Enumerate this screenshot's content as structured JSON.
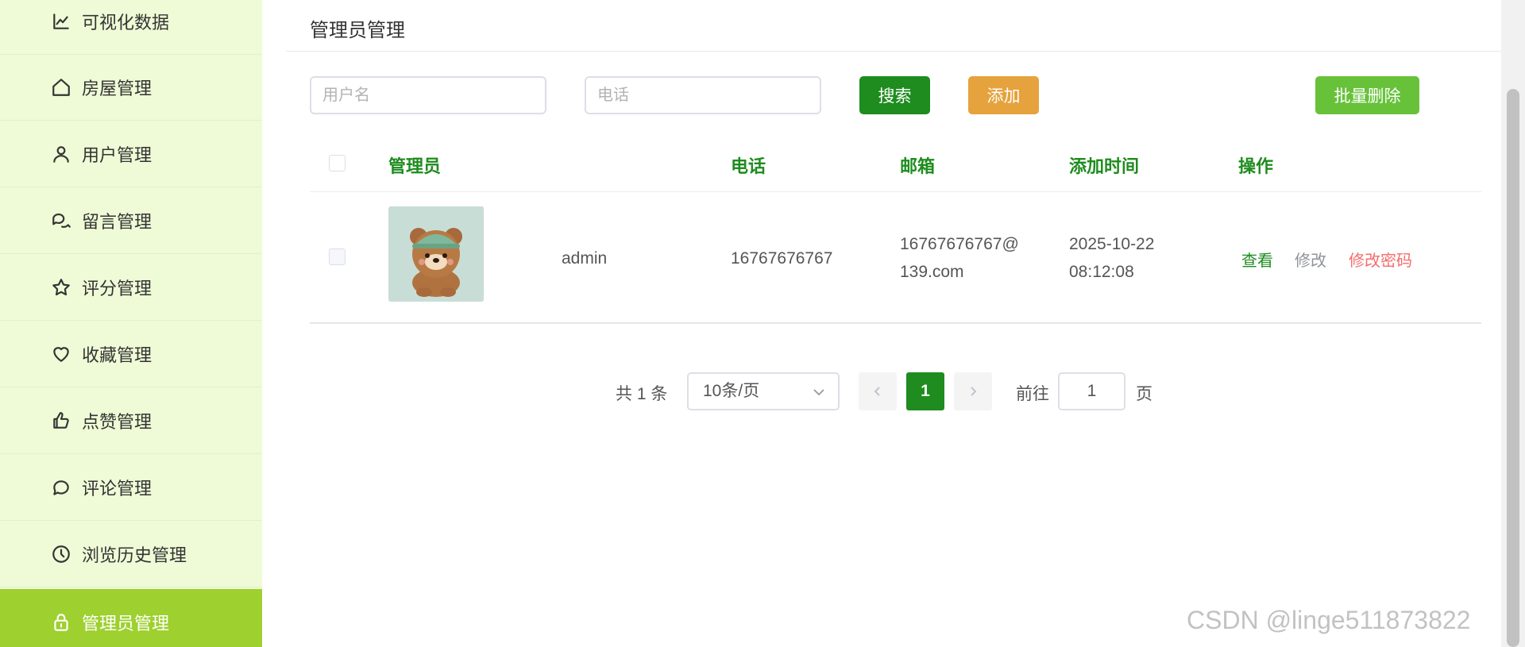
{
  "sidebar": {
    "items": [
      {
        "label": "可视化数据",
        "icon": "chart-line-icon"
      },
      {
        "label": "房屋管理",
        "icon": "home-icon"
      },
      {
        "label": "用户管理",
        "icon": "user-icon"
      },
      {
        "label": "留言管理",
        "icon": "chat-bubbles-icon"
      },
      {
        "label": "评分管理",
        "icon": "star-icon"
      },
      {
        "label": "收藏管理",
        "icon": "heart-icon"
      },
      {
        "label": "点赞管理",
        "icon": "thumbs-up-icon"
      },
      {
        "label": "评论管理",
        "icon": "comment-icon"
      },
      {
        "label": "浏览历史管理",
        "icon": "clock-icon"
      },
      {
        "label": "管理员管理",
        "icon": "lock-icon",
        "active": true
      }
    ]
  },
  "page": {
    "title": "管理员管理"
  },
  "search": {
    "username_placeholder": "用户名",
    "username_value": "",
    "phone_placeholder": "电话",
    "phone_value": ""
  },
  "toolbar": {
    "search_label": "搜索",
    "add_label": "添加",
    "batch_delete_label": "批量删除"
  },
  "table": {
    "headers": {
      "admin": "管理员",
      "phone": "电话",
      "email": "邮箱",
      "added_time": "添加时间",
      "actions": "操作"
    },
    "rows": [
      {
        "avatar": "bear-avatar-image",
        "username": "admin",
        "phone": "16767676767",
        "email_line1": "16767676767@",
        "email_line2": "139.com",
        "date": "2025-10-22",
        "time": "08:12:08",
        "action_view": "查看",
        "action_edit": "修改",
        "action_change_password": "修改密码"
      }
    ]
  },
  "pagination": {
    "total_text": "共 1 条",
    "page_size": "10条/页",
    "current_page": "1",
    "goto_label": "前往",
    "goto_value": "1",
    "page_suffix": "页"
  },
  "watermark": "CSDN @linge511873822",
  "colors": {
    "sidebar_bg": "#eefbd6",
    "sidebar_active": "#9ed02f",
    "primary_green": "#1e8c1e",
    "warning_orange": "#e6a23c",
    "success_green": "#67c23a",
    "danger_red": "#f56c6c"
  }
}
